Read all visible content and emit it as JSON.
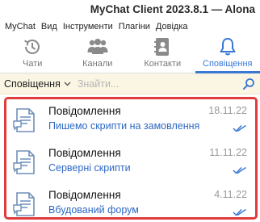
{
  "window": {
    "title": "MyChat Client 2023.8.1 — Alona"
  },
  "menu": {
    "items": [
      "MyChat",
      "Вид",
      "Інструменти",
      "Плагіни",
      "Довідка"
    ]
  },
  "tabs": [
    {
      "label": "Чати",
      "icon": "history-icon"
    },
    {
      "label": "Канали",
      "icon": "group-icon"
    },
    {
      "label": "Контакти",
      "icon": "contacts-book-icon"
    },
    {
      "label": "Сповіщення",
      "icon": "bell-icon",
      "active": true
    }
  ],
  "filter": {
    "selected": "Сповіщення",
    "search_placeholder": "Знайти..."
  },
  "notifications": [
    {
      "title": "Повідомлення",
      "subtitle": "Пишемо скрипти на замовлення",
      "date": "18.11.22"
    },
    {
      "title": "Повідомлення",
      "subtitle": "Серверні скрипти",
      "date": "11.11.22"
    },
    {
      "title": "Повідомлення",
      "subtitle": "Вбудований форум",
      "date": "4.11.22"
    }
  ],
  "colors": {
    "accent": "#3a78d4",
    "filter_bar": "#fbf6e3",
    "highlight_border": "#e23b3b",
    "link": "#2d68c4"
  }
}
